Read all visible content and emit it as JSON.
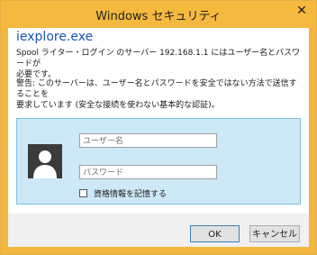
{
  "window": {
    "title": "Windows セキュリティ",
    "close_glyph": "✕"
  },
  "dialog": {
    "app_name": "iexplore.exe",
    "message_line1": "Spool ライター・ログイン  のサーバー 192.168.1.1 にはユーザー名とパスワードが",
    "message_line2": "必要です。",
    "warning_line1": "警告: このサーバーは、ユーザー名とパスワードを安全ではない方法で送信することを",
    "warning_line2": "要求しています (安全な接続を使わない基本的な認証)。"
  },
  "credentials": {
    "username_placeholder": "ユーザー名",
    "password_placeholder": "パスワード",
    "remember_label": "資格情報を記憶する",
    "remember_checked": false,
    "avatar_icon": "user-silhouette-icon"
  },
  "buttons": {
    "ok_label": "OK",
    "cancel_label": "キャンセル"
  },
  "colors": {
    "titlebar": "#f5b940",
    "app_name": "#1a55b4",
    "panel_bg": "#cde8f6",
    "panel_border": "#7fc0e4"
  }
}
